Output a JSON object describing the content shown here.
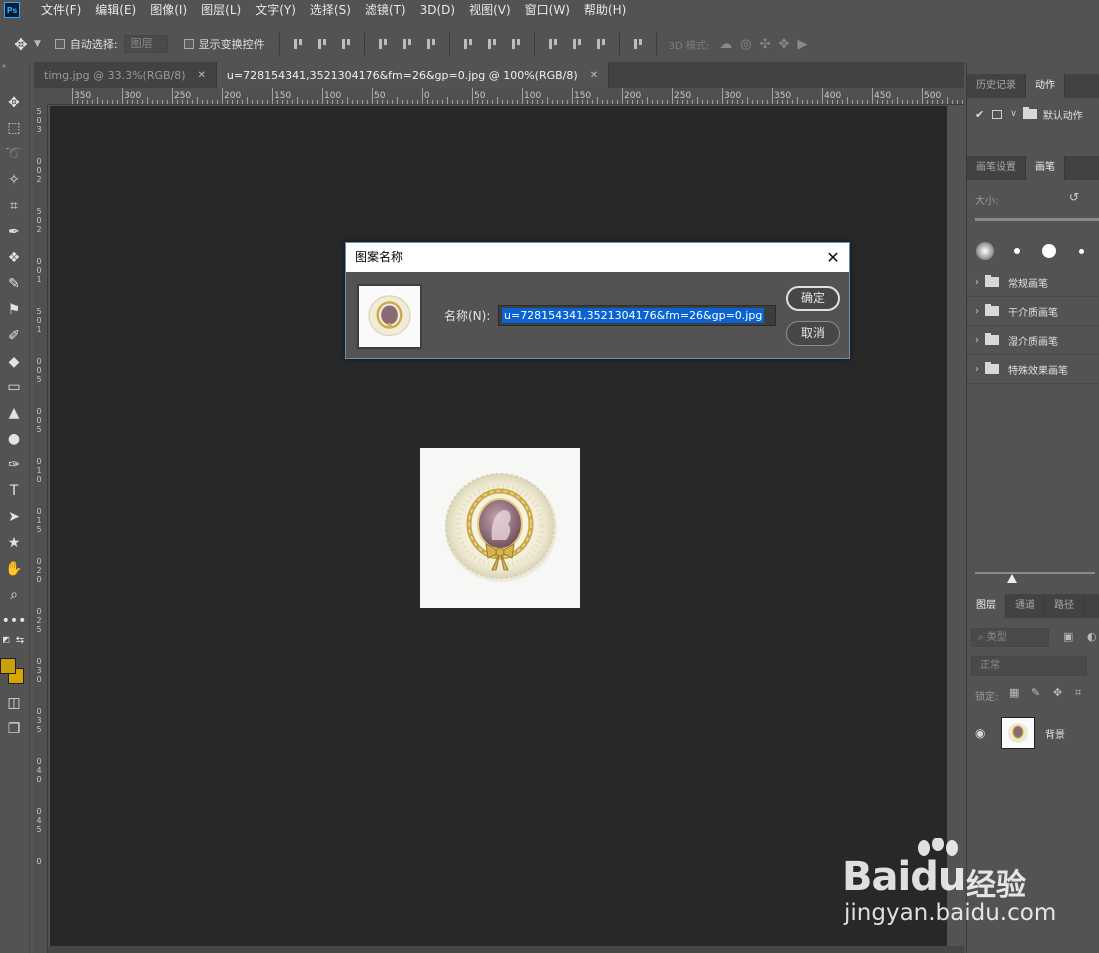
{
  "menu": {
    "items": [
      "文件(F)",
      "编辑(E)",
      "图像(I)",
      "图层(L)",
      "文字(Y)",
      "选择(S)",
      "滤镜(T)",
      "3D(D)",
      "视图(V)",
      "窗口(W)",
      "帮助(H)"
    ],
    "app_logo": "Ps"
  },
  "options": {
    "auto_select_label": "自动选择:",
    "auto_select_target": "图层",
    "show_transform_label": "显示变换控件",
    "mode_3d_label": "3D 模式:"
  },
  "doc_tabs": [
    {
      "label": "timg.jpg @ 33.3%(RGB/8)",
      "active": false
    },
    {
      "label": "u=728154341,3521304176&fm=26&gp=0.jpg @ 100%(RGB/8)",
      "active": true
    }
  ],
  "rulers": {
    "top_labels": [
      "350",
      "300",
      "250",
      "200",
      "150",
      "100",
      "50",
      "0",
      "50",
      "100",
      "150",
      "200",
      "250",
      "300",
      "350",
      "400",
      "450",
      "500"
    ],
    "left_labels": [
      "5",
      "0",
      "3",
      "0",
      "0",
      "2",
      "5",
      "0",
      "2",
      "0",
      "0",
      "1",
      "5",
      "0",
      "1",
      "0",
      "0",
      "5",
      "0",
      "0",
      "5",
      "0",
      "1",
      "0",
      "0",
      "1",
      "5",
      "0",
      "2",
      "0",
      "0",
      "2",
      "5",
      "0",
      "3",
      "0",
      "0",
      "3",
      "5",
      "0",
      "4",
      "0",
      "0",
      "4",
      "5",
      "0"
    ]
  },
  "dialog": {
    "title": "图案名称",
    "name_label": "名称(N):",
    "name_value": "u=728154341,3521304176&fm=26&gp=0.jpg",
    "ok_label": "确定",
    "cancel_label": "取消"
  },
  "panels": {
    "history_tab": "历史记录",
    "actions_tab": "动作",
    "default_actions": "默认动作",
    "brush_settings_tab": "画笔设置",
    "brush_tab": "画笔",
    "size_label": "大小:",
    "brush_groups": [
      "常规画笔",
      "干介质画笔",
      "湿介质画笔",
      "特殊效果画笔"
    ],
    "layers_tab": "图层",
    "channels_tab": "通道",
    "paths_tab": "路径",
    "filter_kind": "类型",
    "blend_mode": "正常",
    "lock_label": "锁定:",
    "layer_name": "背景"
  },
  "watermark": {
    "brand": "Bai",
    "brand2": "du",
    "cn": "经验",
    "url": "jingyan.baidu.com"
  },
  "colors": {
    "foreground": "#c9a10d",
    "background": "#d9a500",
    "selection": "#0a63d0",
    "dialog_border": "#6c8fb8"
  }
}
